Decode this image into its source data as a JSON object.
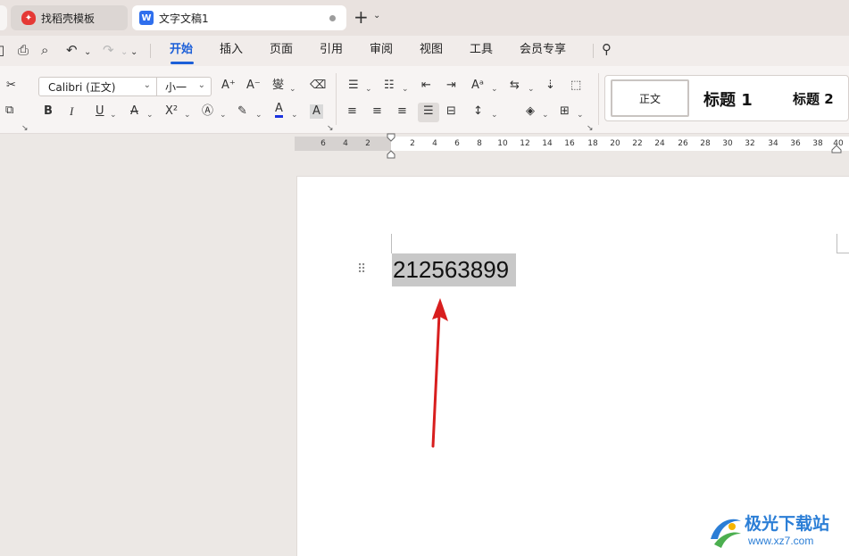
{
  "tabs": [
    {
      "label": "找稻壳模板",
      "icon": "docer-logo-icon"
    },
    {
      "label": "文字文稿1",
      "icon": "wps-writer-icon"
    }
  ],
  "tab_add": "+",
  "menu": {
    "items": [
      "开始",
      "插入",
      "页面",
      "引用",
      "审阅",
      "视图",
      "工具",
      "会员专享"
    ],
    "active": "开始"
  },
  "ribbon": {
    "font_name": "Calibri (正文)",
    "font_size": "小一",
    "bold": "B",
    "italic": "I",
    "underline": "U",
    "strikethrough": "A",
    "superscript": "X²",
    "font_color_letter": "A",
    "char_shading": "A",
    "grow_font": "A⁺",
    "shrink_font": "A⁻",
    "phonetic": "燮",
    "styles": {
      "normal": "正文",
      "heading1": "标题 1",
      "heading2": "标题 2"
    }
  },
  "ruler": {
    "left_numbers": [
      "6",
      "4",
      "2"
    ],
    "right_numbers": [
      "2",
      "4",
      "6",
      "8",
      "10",
      "12",
      "14",
      "16",
      "18",
      "20",
      "22",
      "24",
      "26",
      "28",
      "30",
      "32",
      "34",
      "36",
      "38",
      "40"
    ]
  },
  "document": {
    "selected_text": "212563899"
  },
  "watermark": {
    "title": "极光下载站",
    "url": "www.xz7.com"
  },
  "colors": {
    "accent": "#1c5fd8",
    "selection": "#c8c8c8",
    "arrow": "#d81e1e",
    "font_color_bar": "#1a32e0"
  }
}
